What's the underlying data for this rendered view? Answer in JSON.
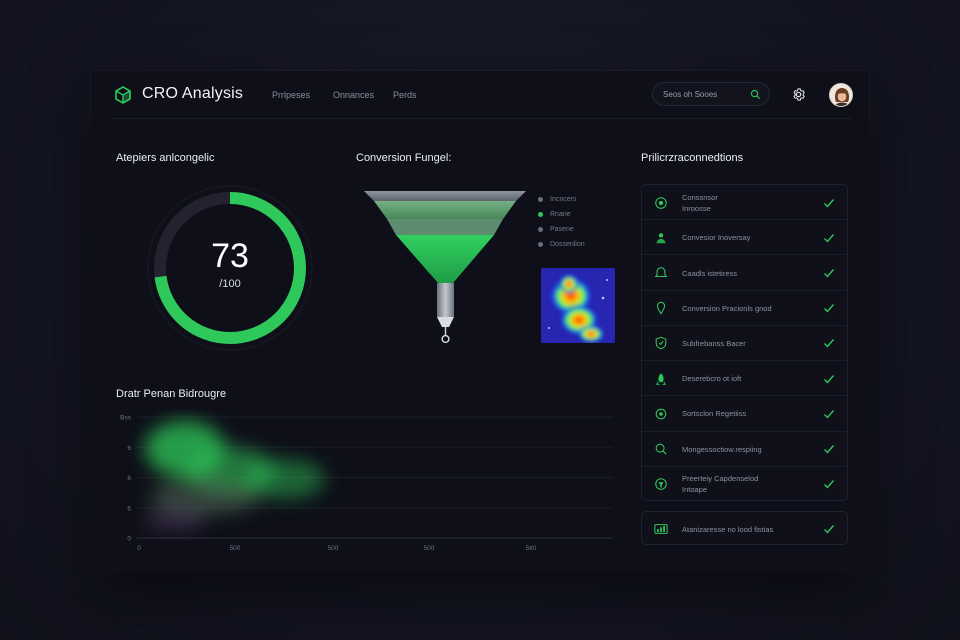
{
  "header": {
    "title": "CRO Analysis",
    "tabs": [
      "Prrlpeses",
      "Onnances",
      "Perds"
    ],
    "search_placeholder": "Seos oh Sooes"
  },
  "score_panel": {
    "title": "Atepiers anlcongelic",
    "value": "73",
    "max_label": "/100",
    "score": 73,
    "max": 100
  },
  "funnel_panel": {
    "title": "Conversion Fungel:",
    "legend": [
      {
        "label": "Incncers",
        "color": "#6b6e7c"
      },
      {
        "label": "Rnane",
        "color": "#2ec95a"
      },
      {
        "label": "Pasene",
        "color": "#6b6e7c"
      },
      {
        "label": "Dossenlion",
        "color": "#6b6e7c"
      }
    ]
  },
  "chart_panel": {
    "title": "Dratr Penan Bidrougre",
    "chart_data": {
      "type": "heatmap",
      "y_ticks": [
        "Bss",
        "6",
        "6",
        "6",
        "0"
      ],
      "x_ticks": [
        "0",
        "500",
        "500",
        "500",
        "5tt0"
      ]
    }
  },
  "recommendations": {
    "title": "Prilicrzraconnedtions",
    "items": [
      {
        "line1": "Conssnsor",
        "line2": "Inroosse"
      },
      {
        "line1": "Convesior Inoversay",
        "line2": ""
      },
      {
        "line1": "Caadls istetiress",
        "line2": ""
      },
      {
        "line1": "Conversion Pracionls gnod",
        "line2": ""
      },
      {
        "line1": "Subfrebanss Bacer",
        "line2": ""
      },
      {
        "line1": "Deserebcro ot ioft",
        "line2": ""
      },
      {
        "line1": "Sortsclon Regetiiss",
        "line2": ""
      },
      {
        "line1": "Mongessoctiow.respiing",
        "line2": ""
      },
      {
        "line1": "Preerteiy Capdenselod",
        "line2": "Intoape"
      }
    ],
    "footer": "Atanizaresse no lood fistias"
  },
  "colors": {
    "accent": "#2ec95a",
    "background": "#0e0f18",
    "panel_border": "#1f2130"
  },
  "icons": {
    "logo": "cube-logo-icon",
    "search": "search-icon",
    "settings": "gear-icon",
    "check": "check-icon"
  }
}
